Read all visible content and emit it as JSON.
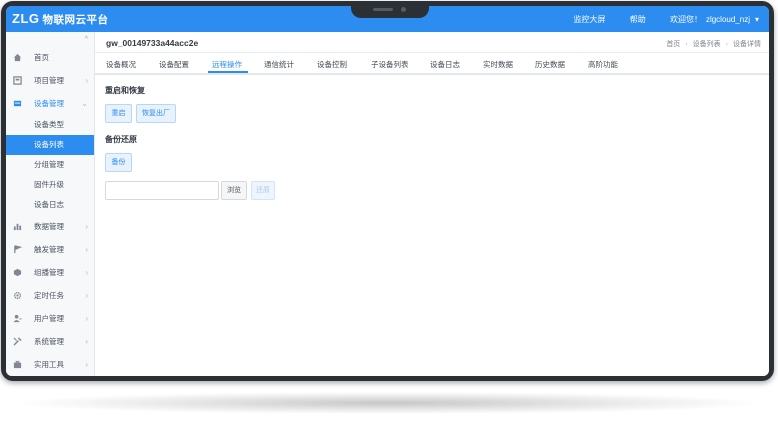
{
  "header": {
    "brand": "ZLG",
    "app_title": "物联网云平台",
    "links": [
      "监控大屏",
      "帮助"
    ],
    "welcome": "欢迎您！",
    "username": "zlgcloud_nzj"
  },
  "sidebar": {
    "items": [
      {
        "label": "首页",
        "icon": "home-icon"
      },
      {
        "label": "项目管理",
        "icon": "project-icon"
      },
      {
        "label": "设备管理",
        "icon": "device-icon"
      },
      {
        "label": "数据管理",
        "icon": "bar-chart-icon"
      },
      {
        "label": "触发管理",
        "icon": "flag-icon"
      },
      {
        "label": "组播管理",
        "icon": "cube-icon"
      },
      {
        "label": "定时任务",
        "icon": "gear-icon"
      },
      {
        "label": "用户管理",
        "icon": "user-icon"
      },
      {
        "label": "系统管理",
        "icon": "tools-icon"
      },
      {
        "label": "实用工具",
        "icon": "toolbox-icon"
      }
    ],
    "device_sub": [
      "设备类型",
      "设备列表",
      "分组管理",
      "固件升级",
      "设备日志"
    ]
  },
  "page": {
    "title": "gw_00149733a44acc2e",
    "breadcrumb": [
      "首页",
      "设备列表",
      "设备详情"
    ]
  },
  "tabs": [
    "设备概况",
    "设备配置",
    "远程操作",
    "通信统计",
    "设备控制",
    "子设备列表",
    "设备日志",
    "实时数据",
    "历史数据",
    "高阶功能"
  ],
  "restart_section": {
    "title": "重启和恢复",
    "restart_label": "重启",
    "factory_label": "恢复出厂"
  },
  "backup_section": {
    "title": "备份还原",
    "backup_label": "备份",
    "browse_label": "浏览",
    "restore_label": "还原",
    "file_value": ""
  },
  "colors": {
    "accent": "#2d8cf0",
    "sidebar_bg": "#f7f8fa",
    "device_frame": "#2b2f36"
  }
}
